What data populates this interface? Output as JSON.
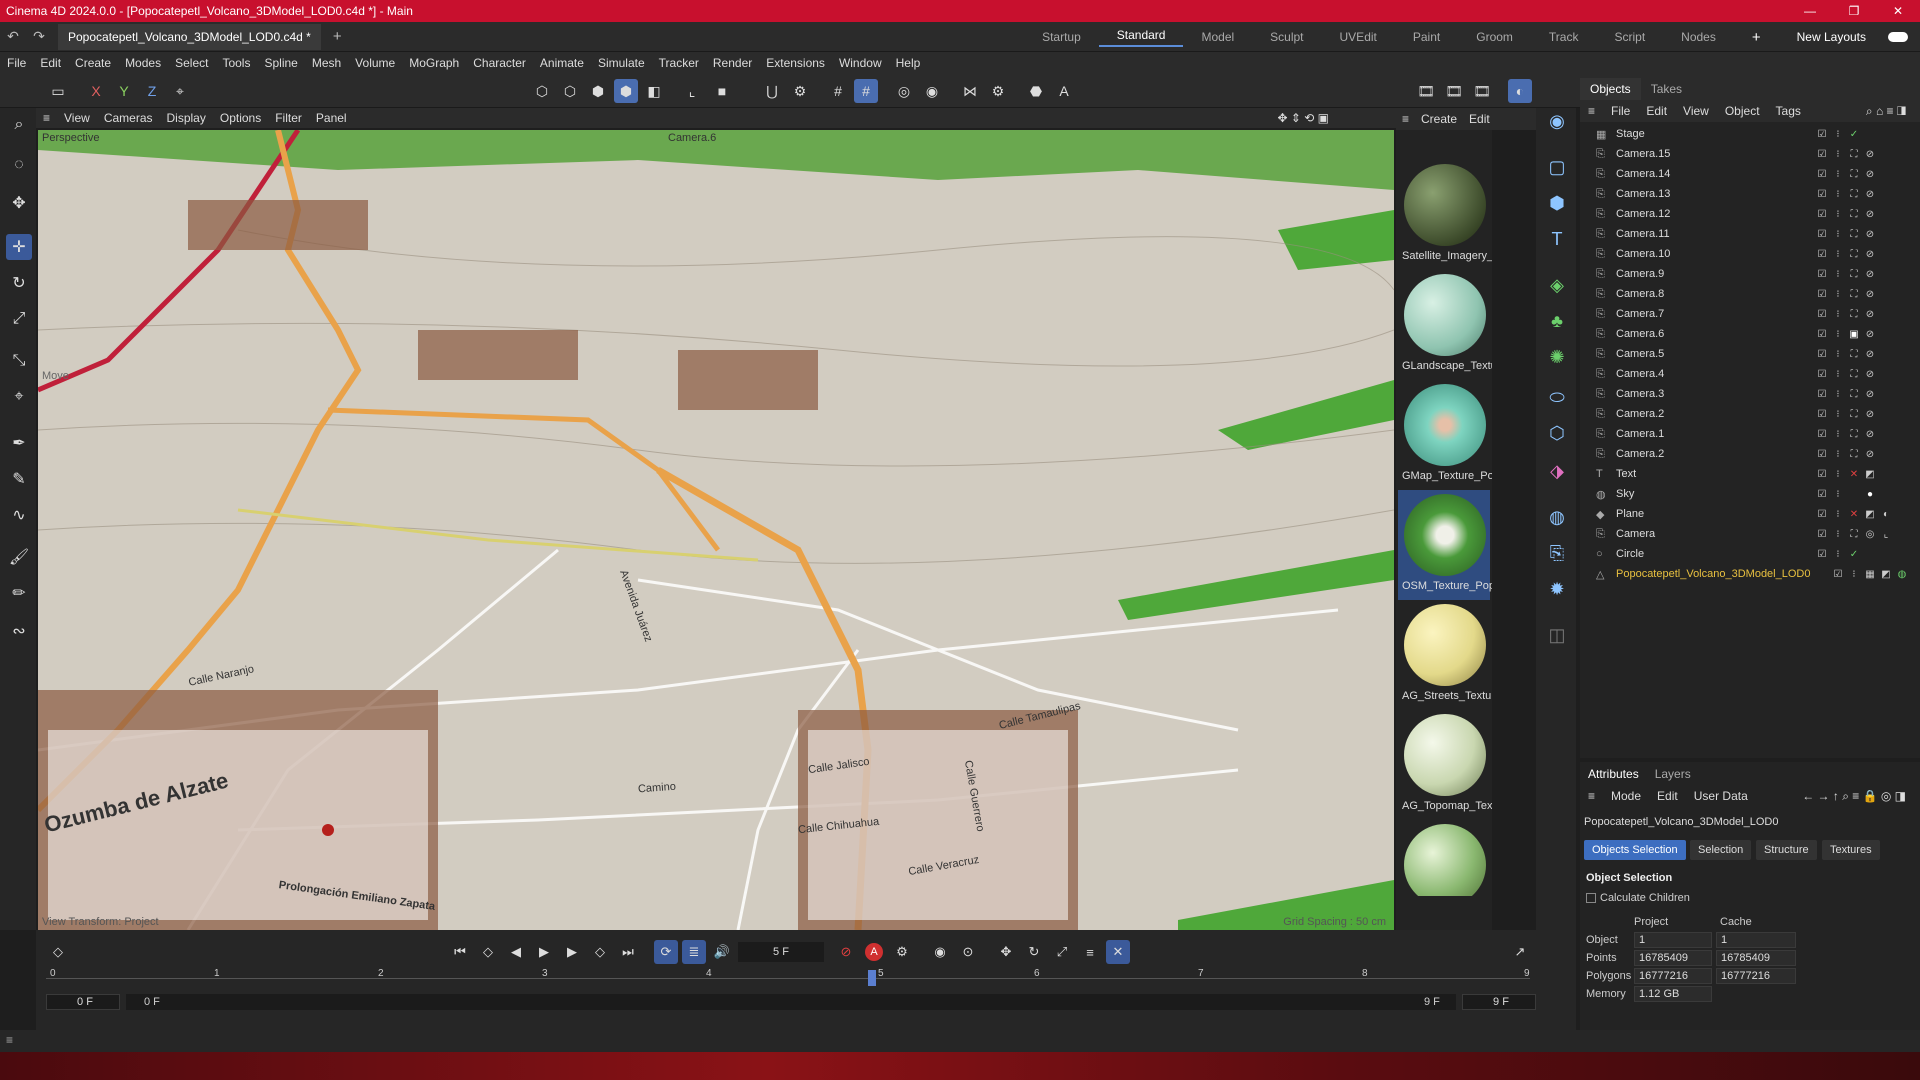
{
  "window": {
    "title": "Cinema 4D 2024.0.0 - [Popocatepetl_Volcano_3DModel_LOD0.c4d *] - Main"
  },
  "tabs": {
    "doc": "Popocatepetl_Volcano_3DModel_LOD0.c4d *"
  },
  "layouts": [
    "Startup",
    "Standard",
    "Model",
    "Sculpt",
    "UVEdit",
    "Paint",
    "Groom",
    "Track",
    "Script",
    "Nodes"
  ],
  "layouts_new": "New Layouts",
  "menu": [
    "File",
    "Edit",
    "Create",
    "Modes",
    "Select",
    "Tools",
    "Spline",
    "Mesh",
    "Volume",
    "MoGraph",
    "Character",
    "Animate",
    "Simulate",
    "Tracker",
    "Render",
    "Extensions",
    "Window",
    "Help"
  ],
  "viewport": {
    "menu": [
      "View",
      "Cameras",
      "Display",
      "Options",
      "Filter",
      "Panel"
    ],
    "label_left": "Perspective",
    "label_camera": "Camera.6",
    "hud_bottom_left": "View Transform: Project",
    "grid_spacing": "Grid Spacing : 50 cm",
    "move_label": "Move",
    "town_label": "Ozumba de Alzate",
    "streets": [
      "Calle Jalisco",
      "Calle Chihuahua",
      "Calle Veracruz",
      "Calle Tamaulipas",
      "Calle Naranjo",
      "Camino",
      "Prolongación Emiliano Zapata",
      "Avenida Juárez",
      "Calle Guerrero"
    ]
  },
  "materials": {
    "menu": [
      "Create",
      "Edit"
    ],
    "items": [
      {
        "name": "Satellite_Imagery_",
        "color": "#3c4a2a"
      },
      {
        "name": "GLandscape_Textu",
        "color": "#8fc4b0"
      },
      {
        "name": "GMap_Texture_Po",
        "color": "#7ed4c0"
      },
      {
        "name": "OSM_Texture_Pop",
        "color": "#4a9a3a"
      },
      {
        "name": "AG_Streets_Textur",
        "color": "#e3d98a"
      },
      {
        "name": "AG_Topomap_Tex",
        "color": "#c9d7b0"
      },
      {
        "name": "",
        "color": "#8ab870"
      }
    ]
  },
  "objects": {
    "tabs": [
      "Objects",
      "Takes"
    ],
    "menu": [
      "File",
      "Edit",
      "View",
      "Object",
      "Tags"
    ],
    "rows": [
      "Stage",
      "Camera.15",
      "Camera.14",
      "Camera.13",
      "Camera.12",
      "Camera.11",
      "Camera.10",
      "Camera.9",
      "Camera.8",
      "Camera.7",
      "Camera.6",
      "Camera.5",
      "Camera.4",
      "Camera.3",
      "Camera.2",
      "Camera.1",
      "Camera.2",
      "Text",
      "Sky",
      "Plane",
      "Camera",
      "Circle",
      "Popocatepetl_Volcano_3DModel_LOD0"
    ]
  },
  "attributes": {
    "tabs": [
      "Attributes",
      "Layers"
    ],
    "menu": [
      "Mode",
      "Edit",
      "User Data"
    ],
    "object_name": "Popocatepetl_Volcano_3DModel_LOD0",
    "buttons": [
      "Objects Selection",
      "Selection",
      "Structure",
      "Textures"
    ],
    "section": "Object Selection",
    "checkbox": "Calculate Children",
    "col_project": "Project",
    "col_cache": "Cache",
    "rows": [
      {
        "label": "Object",
        "project": "1",
        "cache": "1"
      },
      {
        "label": "Points",
        "project": "16785409",
        "cache": "16785409"
      },
      {
        "label": "Polygons",
        "project": "16777216",
        "cache": "16777216"
      },
      {
        "label": "Memory",
        "project": "1.12 GB",
        "cache": ""
      }
    ]
  },
  "timeline": {
    "current_frame": "5 F",
    "start": "0 F",
    "start2": "0 F",
    "end": "9 F",
    "end2": "9 F",
    "ticks": [
      "0",
      "1",
      "2",
      "3",
      "4",
      "5",
      "6",
      "7",
      "8",
      "9"
    ]
  }
}
